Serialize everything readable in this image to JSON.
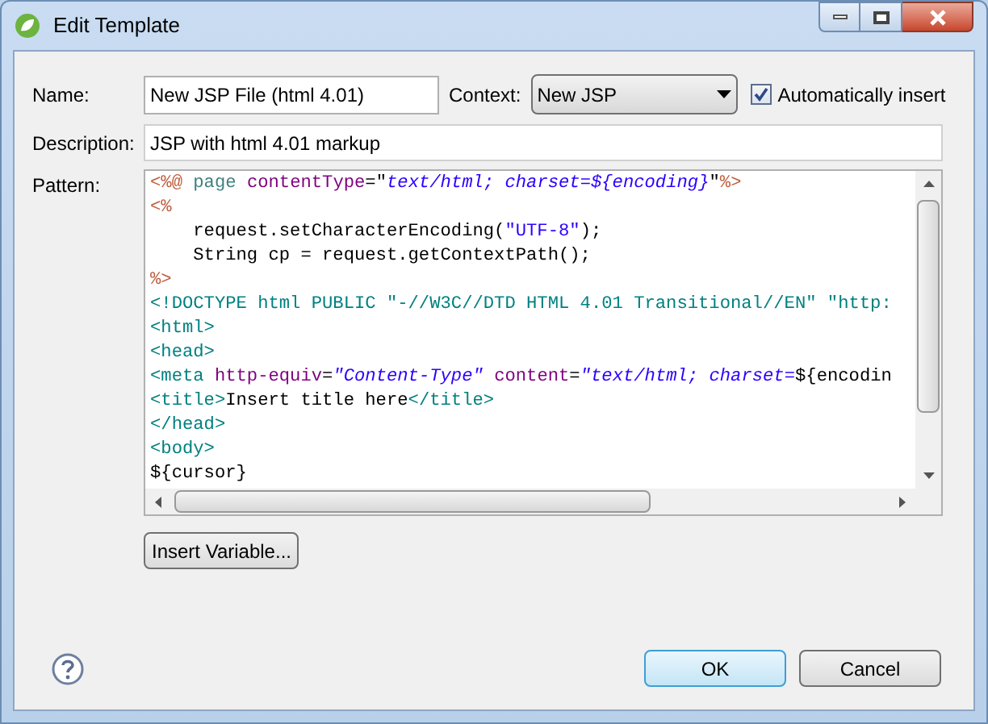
{
  "window": {
    "title": "Edit Template"
  },
  "name": {
    "label": "Name:",
    "value": "New JSP File (html 4.01)"
  },
  "context": {
    "label": "Context:",
    "value": "New JSP"
  },
  "auto_insert": {
    "label": "Automatically insert",
    "checked": true
  },
  "description": {
    "label": "Description:",
    "value": "JSP with html 4.01 markup"
  },
  "pattern": {
    "label": "Pattern:",
    "lines": [
      [
        {
          "kind": "delim",
          "text": "<%@"
        },
        {
          "kind": "directive",
          "text": " page "
        },
        {
          "kind": "attr",
          "text": "contentType"
        },
        {
          "kind": "plain",
          "text": "=\""
        },
        {
          "kind": "value",
          "text": "text/html; charset=${encoding}"
        },
        {
          "kind": "plain",
          "text": "\""
        },
        {
          "kind": "delim",
          "text": "%>"
        }
      ],
      [
        {
          "kind": "delim",
          "text": "<%"
        }
      ],
      [
        {
          "kind": "plain",
          "text": "    request.setCharacterEncoding("
        },
        {
          "kind": "string",
          "text": "\"UTF-8\""
        },
        {
          "kind": "plain",
          "text": ");"
        }
      ],
      [
        {
          "kind": "plain",
          "text": "    String cp = request.getContextPath();"
        }
      ],
      [
        {
          "kind": "delim",
          "text": "%>"
        }
      ],
      [
        {
          "kind": "tag",
          "text": "<!DOCTYPE html PUBLIC \"-//W3C//DTD HTML 4.01 Transitional//EN\" \"http:"
        }
      ],
      [
        {
          "kind": "tag",
          "text": "<html>"
        }
      ],
      [
        {
          "kind": "tag",
          "text": "<head>"
        }
      ],
      [
        {
          "kind": "tag",
          "text": "<meta"
        },
        {
          "kind": "attr",
          "text": " http-equiv"
        },
        {
          "kind": "plain",
          "text": "="
        },
        {
          "kind": "value",
          "text": "\"Content-Type\""
        },
        {
          "kind": "attr",
          "text": " content"
        },
        {
          "kind": "plain",
          "text": "="
        },
        {
          "kind": "value",
          "text": "\"text/html; charset="
        },
        {
          "kind": "plain",
          "text": "${encodin"
        }
      ],
      [
        {
          "kind": "tag",
          "text": "<title>"
        },
        {
          "kind": "plain",
          "text": "Insert title here"
        },
        {
          "kind": "tag",
          "text": "</title>"
        }
      ],
      [
        {
          "kind": "tag",
          "text": "</head>"
        }
      ],
      [
        {
          "kind": "tag",
          "text": "<body>"
        }
      ],
      [
        {
          "kind": "plain",
          "text": "${cursor}"
        }
      ]
    ]
  },
  "insert_variable": "Insert Variable...",
  "buttons": [
    {
      "label": "OK",
      "default": true
    },
    {
      "label": "Cancel",
      "default": false
    }
  ]
}
